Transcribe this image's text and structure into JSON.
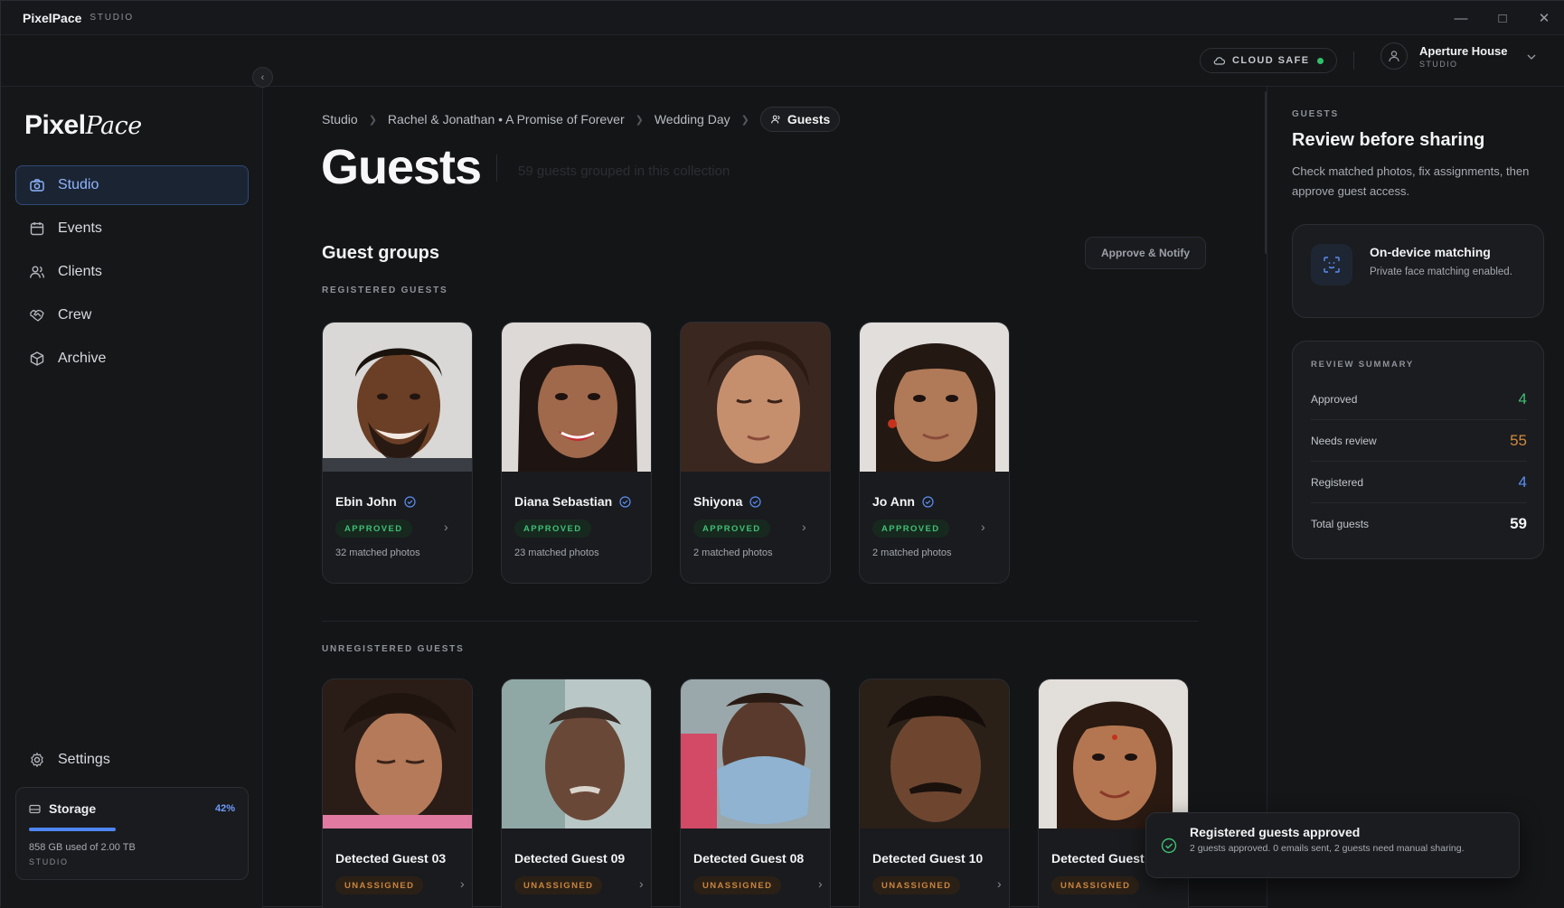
{
  "window": {
    "brand": "PixelPace",
    "brand_sub": "STUDIO"
  },
  "header": {
    "cloud_label": "CLOUD SAFE",
    "user": {
      "name": "Aperture House",
      "role": "STUDIO"
    }
  },
  "sidebar": {
    "logo_main": "Pixel",
    "logo_script": "Pace",
    "items": [
      {
        "label": "Studio",
        "icon": "camera-icon",
        "active": true
      },
      {
        "label": "Events",
        "icon": "calendar-icon"
      },
      {
        "label": "Clients",
        "icon": "users-icon"
      },
      {
        "label": "Crew",
        "icon": "handshake-icon"
      },
      {
        "label": "Archive",
        "icon": "box-icon"
      }
    ],
    "settings_label": "Settings",
    "storage": {
      "label": "Storage",
      "percent": "42%",
      "used": "858 GB used of 2.00 TB",
      "plan": "STUDIO"
    }
  },
  "breadcrumb": [
    "Studio",
    "Rachel & Jonathan • A Promise of Forever",
    "Wedding Day",
    "Guests"
  ],
  "page": {
    "title": "Guests",
    "subtitle": "59 guests grouped in this collection",
    "section_title": "Guest groups",
    "approve_button": "Approve & Notify",
    "registered_caption": "REGISTERED GUESTS",
    "unregistered_caption": "UNREGISTERED GUESTS"
  },
  "registered_guests": [
    {
      "name": "Ebin John",
      "status": "APPROVED",
      "photos": "32 matched photos"
    },
    {
      "name": "Diana Sebastian",
      "status": "APPROVED",
      "photos": "23 matched photos"
    },
    {
      "name": "Shiyona",
      "status": "APPROVED",
      "photos": "2 matched photos"
    },
    {
      "name": "Jo Ann",
      "status": "APPROVED",
      "photos": "2 matched photos"
    }
  ],
  "unregistered_guests": [
    {
      "name": "Detected Guest 03",
      "status": "UNASSIGNED"
    },
    {
      "name": "Detected Guest 09",
      "status": "UNASSIGNED"
    },
    {
      "name": "Detected Guest 08",
      "status": "UNASSIGNED"
    },
    {
      "name": "Detected Guest 10",
      "status": "UNASSIGNED"
    },
    {
      "name": "Detected Guest",
      "status": "UNASSIGNED"
    }
  ],
  "right_panel": {
    "caption": "GUESTS",
    "title": "Review before sharing",
    "description": "Check matched photos, fix assignments, then approve guest access.",
    "matching": {
      "title": "On-device matching",
      "desc": "Private face matching enabled."
    },
    "summary": {
      "caption": "REVIEW SUMMARY",
      "rows": [
        {
          "label": "Approved",
          "value": "4",
          "color": "#3fbf74"
        },
        {
          "label": "Needs review",
          "value": "55",
          "color": "#d08a3e"
        },
        {
          "label": "Registered",
          "value": "4",
          "color": "#5b8ff5"
        },
        {
          "label": "Total guests",
          "value": "59",
          "color": "#f3f4f6"
        }
      ]
    }
  },
  "toast": {
    "title": "Registered guests approved",
    "desc": "2 guests approved. 0 emails sent, 2 guests need manual sharing."
  },
  "colors": {
    "accent": "#4f85f4",
    "approved": "#3fbf74",
    "unassigned": "#c8853f",
    "background": "#141517"
  }
}
